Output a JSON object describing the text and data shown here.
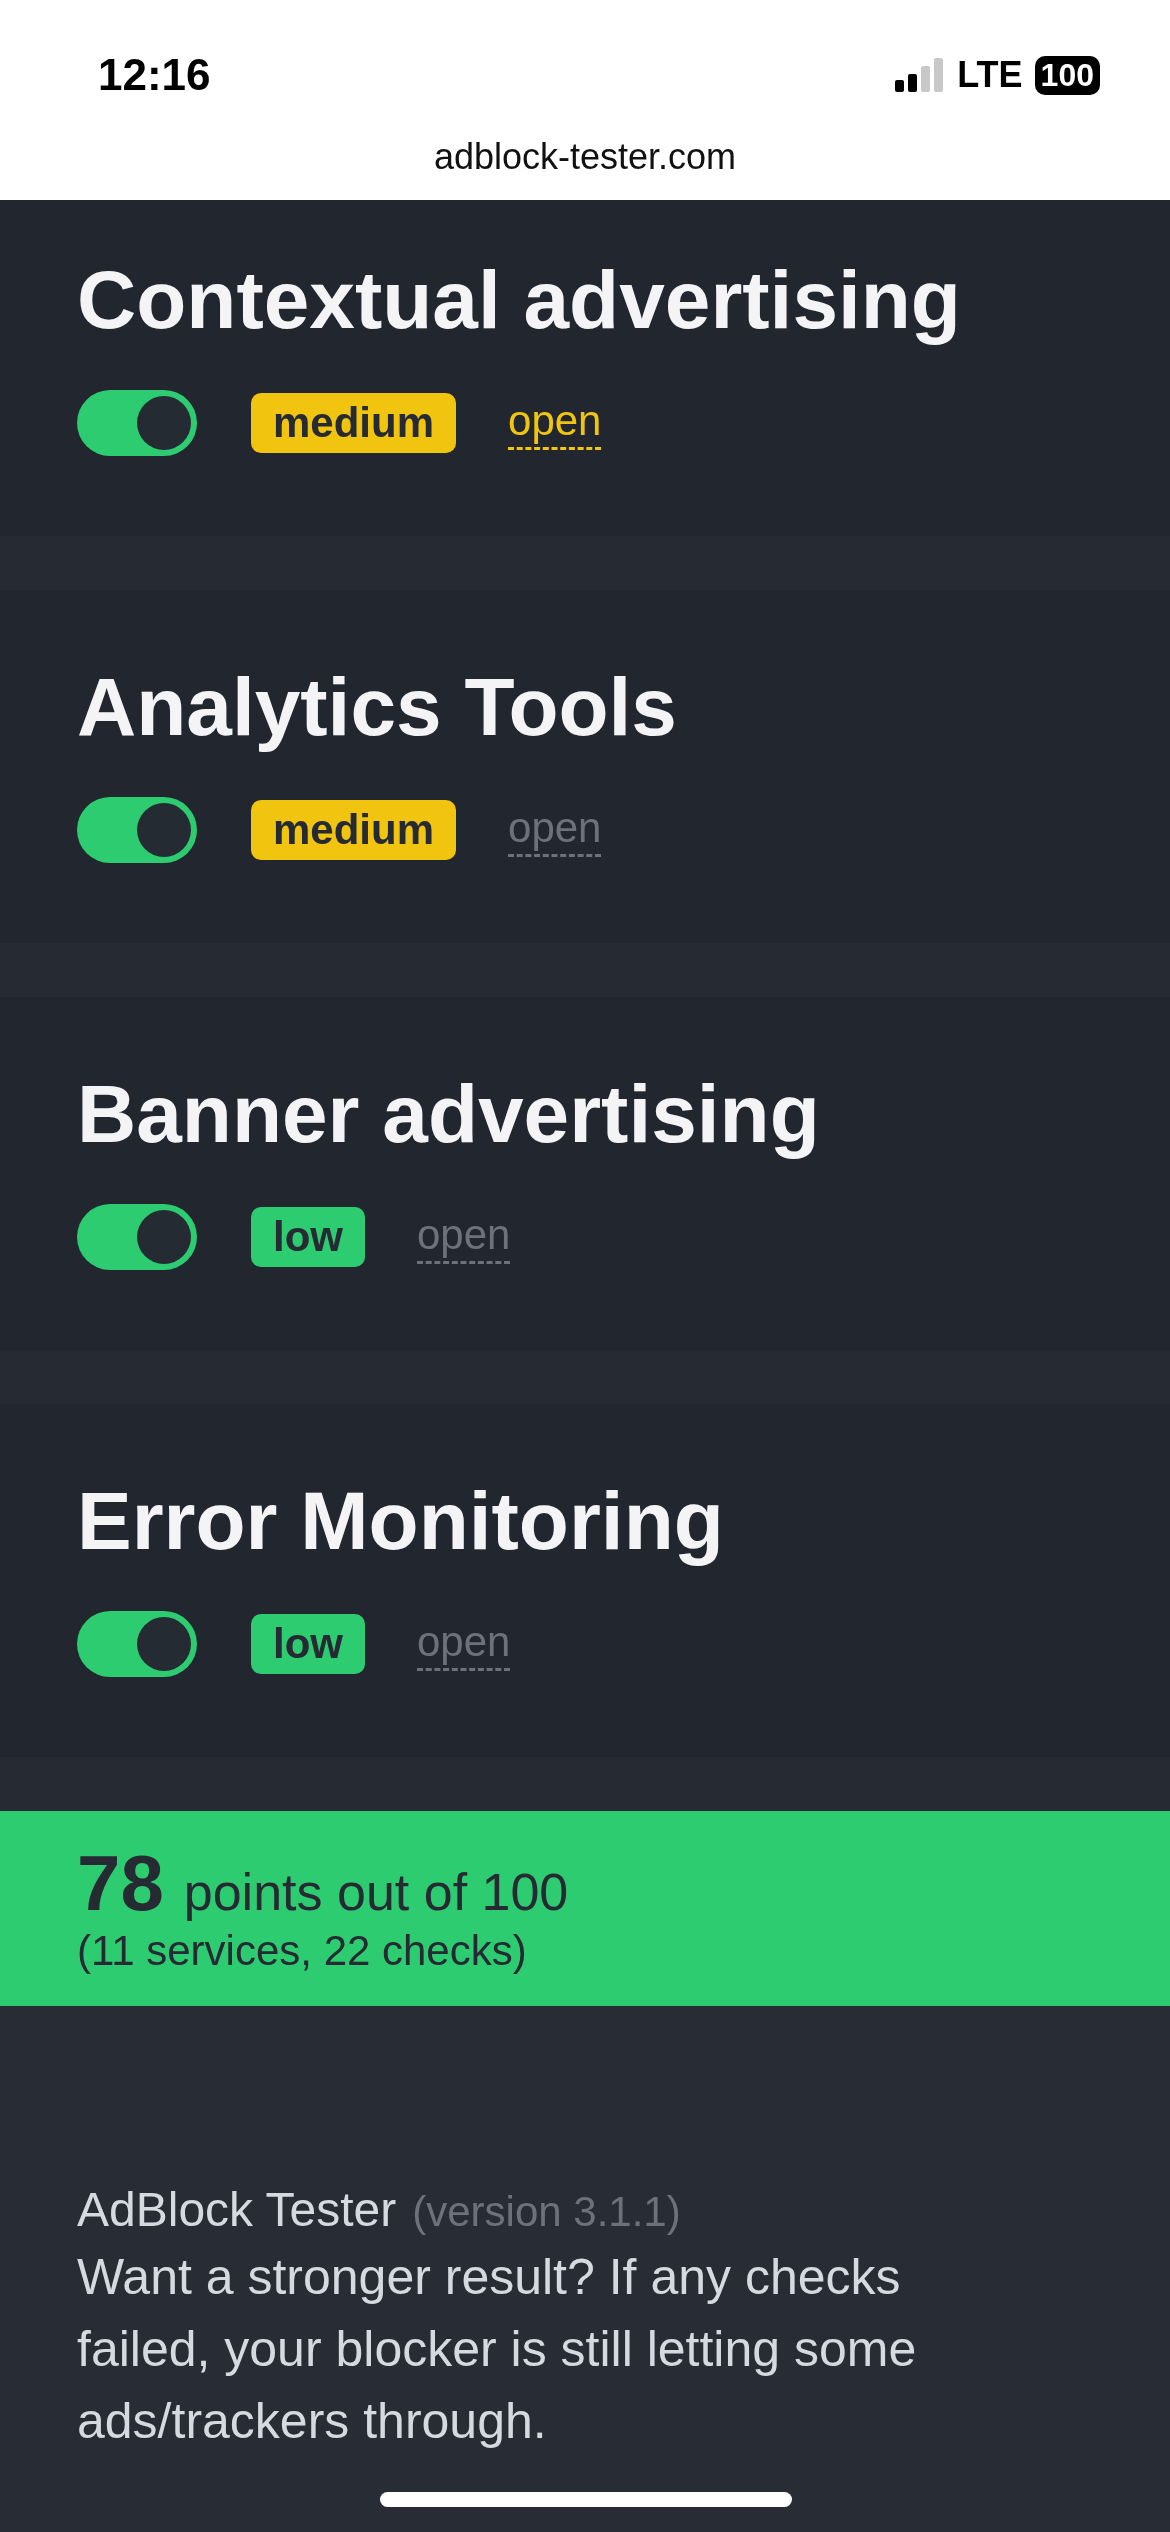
{
  "status_bar": {
    "time": "12:16",
    "network": "LTE",
    "battery": "100"
  },
  "address_bar": {
    "url": "adblock-tester.com"
  },
  "services": [
    {
      "title": "Contextual advertising",
      "on": true,
      "severity": "medium",
      "link": "open",
      "active": true
    },
    {
      "title": "Analytics Tools",
      "on": true,
      "severity": "medium",
      "link": "open",
      "active": false
    },
    {
      "title": "Banner advertising",
      "on": true,
      "severity": "low",
      "link": "open",
      "active": false
    },
    {
      "title": "Error Monitoring",
      "on": true,
      "severity": "low",
      "link": "open",
      "active": false
    }
  ],
  "score": {
    "points": "78",
    "label": "points out of 100",
    "detail": "(11 services, 22 checks)"
  },
  "footer": {
    "name": "AdBlock Tester",
    "version": "(version 3.1.1)",
    "text": "Want a stronger result? If any checks failed, your blocker is still letting some ads/trackers through."
  }
}
